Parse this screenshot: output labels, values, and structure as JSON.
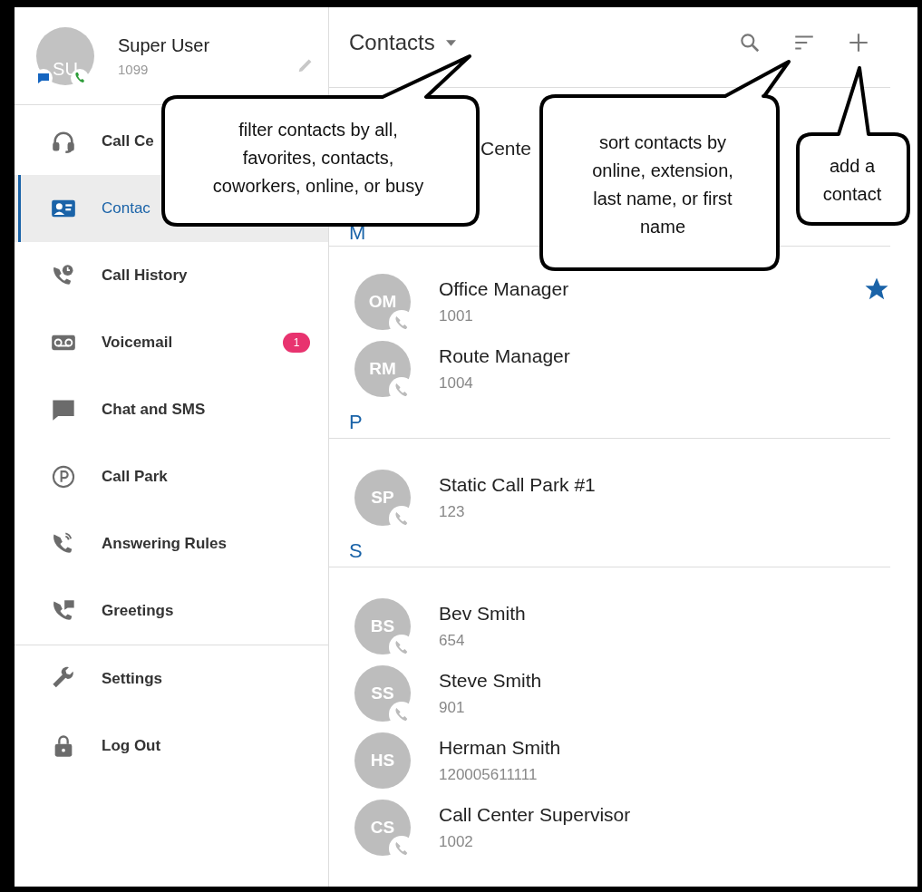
{
  "user": {
    "initials": "SU",
    "name": "Super User",
    "extension": "1099"
  },
  "nav": [
    {
      "label": "Call Ce",
      "selected": false
    },
    {
      "label": "Contac",
      "selected": true
    },
    {
      "label": "Call History",
      "selected": false
    },
    {
      "label": "Voicemail",
      "selected": false,
      "badge": "1"
    },
    {
      "label": "Chat and SMS",
      "selected": false
    },
    {
      "label": "Call Park",
      "selected": false
    },
    {
      "label": "Answering Rules",
      "selected": false
    },
    {
      "label": "Greetings",
      "selected": false
    }
  ],
  "nav_bottom": [
    {
      "label": "Settings",
      "selected": false
    },
    {
      "label": "Log Out",
      "selected": false
    }
  ],
  "header": {
    "title": "Contacts"
  },
  "partial_row": {
    "name": "Cente"
  },
  "sections": [
    {
      "letter": "M",
      "contacts": [
        {
          "initials": "OM",
          "name": "Office Manager",
          "extension": "1001",
          "phone_badge": true,
          "favorite": true
        },
        {
          "initials": "RM",
          "name": "Route Manager",
          "extension": "1004",
          "phone_badge": true,
          "favorite": false
        }
      ]
    },
    {
      "letter": "P",
      "contacts": [
        {
          "initials": "SP",
          "name": "Static Call Park #1",
          "extension": "123",
          "phone_badge": true,
          "favorite": false
        }
      ]
    },
    {
      "letter": "S",
      "contacts": [
        {
          "initials": "BS",
          "name": "Bev Smith",
          "extension": "654",
          "phone_badge": true,
          "favorite": false
        },
        {
          "initials": "SS",
          "name": "Steve Smith",
          "extension": "901",
          "phone_badge": true,
          "favorite": false
        },
        {
          "initials": "HS",
          "name": "Herman Smith",
          "extension": "120005611111",
          "phone_badge": false,
          "favorite": false
        },
        {
          "initials": "CS",
          "name": "Call Center Supervisor",
          "extension": "1002",
          "phone_badge": true,
          "favorite": false
        }
      ]
    }
  ],
  "callouts": [
    "filter contacts by all,\nfavorites, contacts,\ncoworkers, online, or busy",
    "sort contacts by\nonline, extension,\nlast name, or first\nname",
    "add a\ncontact"
  ]
}
